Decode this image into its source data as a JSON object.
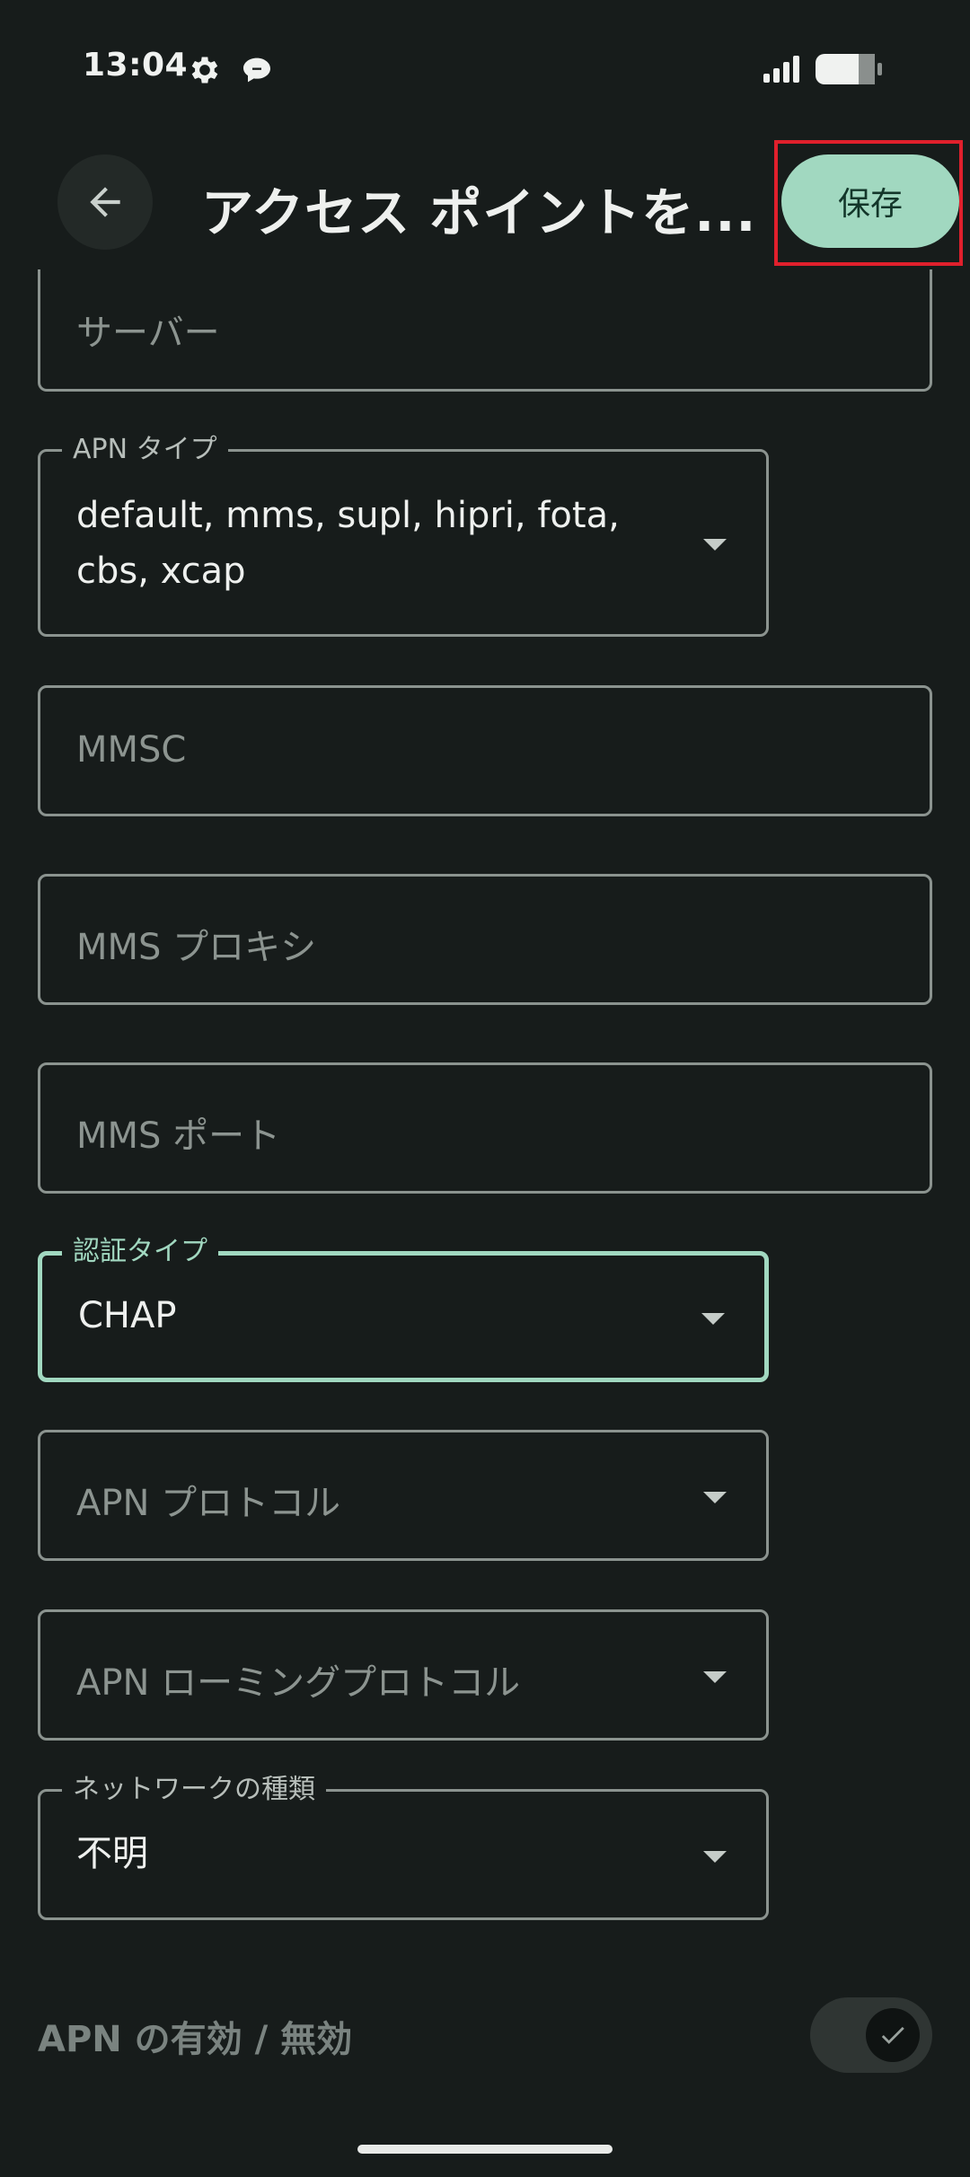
{
  "status_bar": {
    "time": "13:04",
    "icons": [
      "gear-icon",
      "chat-bubble-icon",
      "cellular-signal-icon",
      "battery-icon"
    ]
  },
  "app_bar": {
    "title": "アクセス ポイントを...",
    "back_icon": "arrow-left-icon",
    "save_label": "保存"
  },
  "form": {
    "server": {
      "placeholder": "サーバー"
    },
    "apn_type": {
      "label": "APN タイプ",
      "value_line1": "default, mms, supl, hipri, fota,",
      "value_line2": "cbs, xcap"
    },
    "mmsc": {
      "placeholder": "MMSC"
    },
    "mms_proxy": {
      "placeholder": "MMS プロキシ"
    },
    "mms_port": {
      "placeholder": "MMS ポート"
    },
    "auth_type": {
      "label": "認証タイプ",
      "value": "CHAP"
    },
    "apn_protocol": {
      "placeholder": "APN プロトコル"
    },
    "apn_roaming_protocol": {
      "placeholder": "APN ローミングプロトコル"
    },
    "network_type": {
      "label": "ネットワークの種類",
      "value": "不明"
    }
  },
  "apn_toggle": {
    "label": "APN の有効 / 無効",
    "checked": true
  },
  "colors": {
    "background": "#171c1b",
    "accent": "#a1d8c0",
    "outline": "#8b938f",
    "highlight": "#e0202c"
  }
}
